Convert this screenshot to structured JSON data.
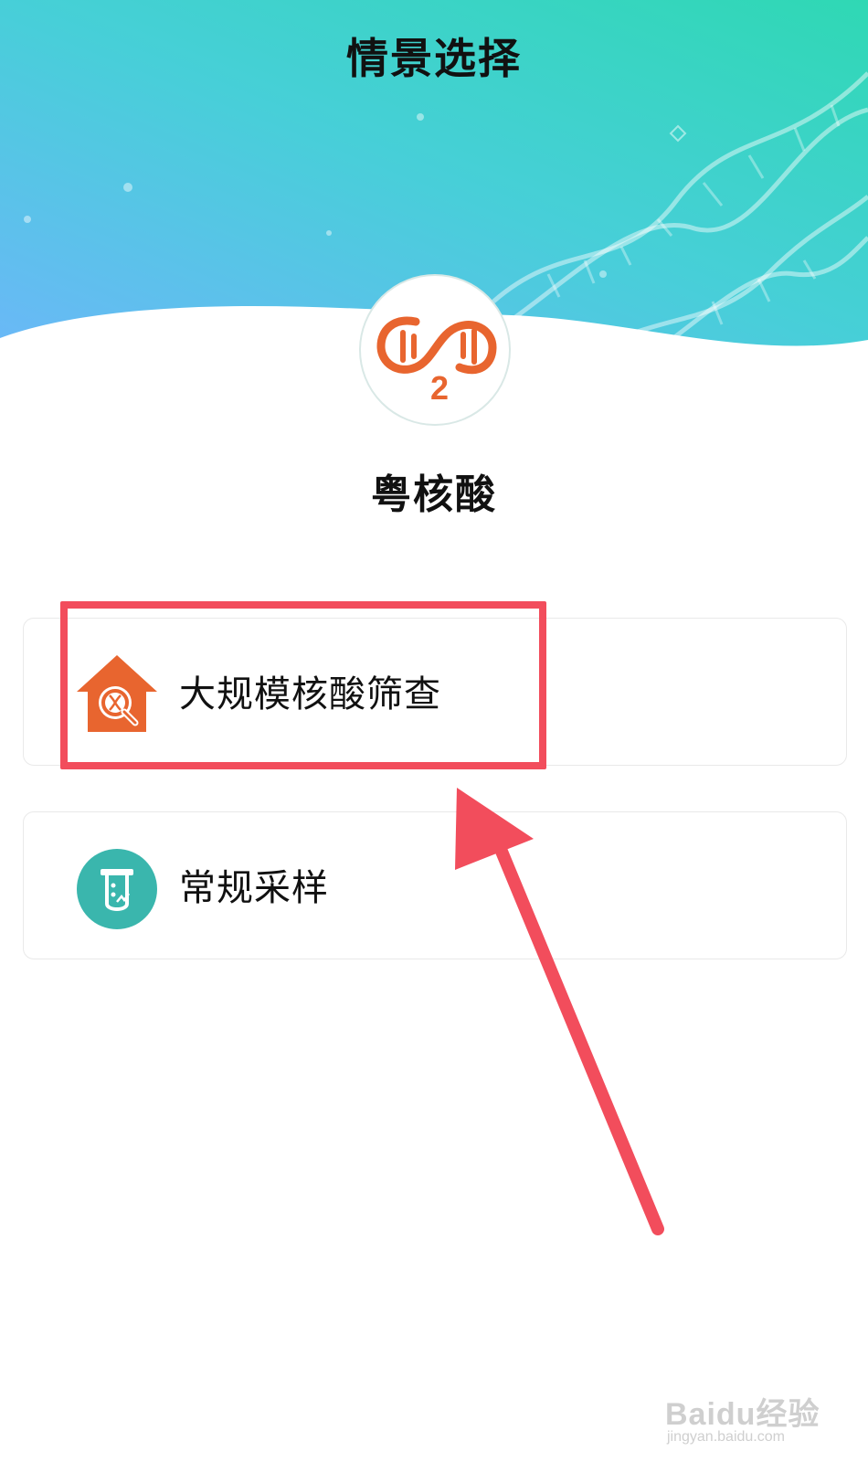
{
  "header": {
    "title": "情景选择"
  },
  "app": {
    "name": "粤核酸",
    "logo_icon": "dna-2-logo-icon",
    "logo_subscript": "2"
  },
  "options": [
    {
      "label": "大规模核酸筛查",
      "icon": "house-magnifier-icon"
    },
    {
      "label": "常规采样",
      "icon": "test-tube-icon"
    }
  ],
  "watermark": {
    "main": "Baidu经验",
    "sub": "jingyan.baidu.com"
  },
  "colors": {
    "header_gradient_start": "#6ab8f7",
    "header_gradient_end": "#2fd8b4",
    "accent_orange": "#e8652f",
    "teal": "#3ab6ad",
    "annotation_red": "#f24d5c"
  }
}
